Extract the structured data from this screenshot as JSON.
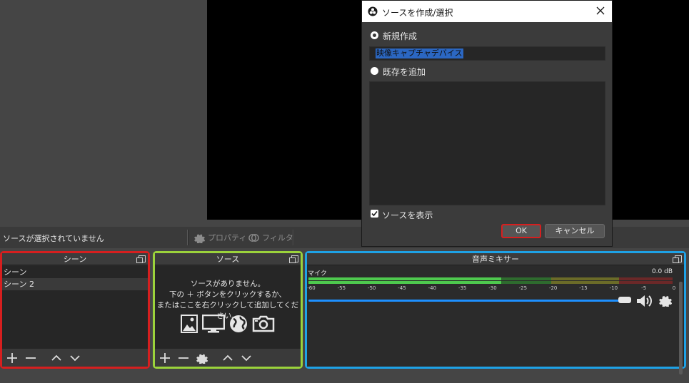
{
  "context_bar": {
    "status": "ソースが選択されていません",
    "properties_label": "プロパティ",
    "filters_label": "フィルタ"
  },
  "scenes_dock": {
    "title": "シーン",
    "items": [
      "シーン",
      "シーン 2"
    ]
  },
  "sources_dock": {
    "title": "ソース",
    "empty_line1": "ソースがありません。",
    "empty_line2": "下の ＋ ボタンをクリックするか、",
    "empty_line3": "またはここを右クリックして追加してください。",
    "icons": [
      "image-icon",
      "display-icon",
      "browser-globe-icon",
      "camera-icon"
    ]
  },
  "mixer_dock": {
    "title": "音声ミキサー",
    "channel_name": "マイク",
    "db_value": "0.0 dB",
    "ticks": [
      "-60",
      "-55",
      "-50",
      "-45",
      "-40",
      "-35",
      "-30",
      "-25",
      "-20",
      "-15",
      "-10",
      "-5",
      "0"
    ],
    "volume_level": 1.0
  },
  "dialog": {
    "title": "ソースを作成/選択",
    "create_new_label": "新規作成",
    "source_name_value": "映像キャプチャデバイス",
    "add_existing_label": "既存を追加",
    "show_source_label": "ソースを表示",
    "ok_label": "OK",
    "cancel_label": "キャンセル"
  },
  "colors": {
    "scenes_highlight": "#d61f1f",
    "sources_highlight": "#9bd33b",
    "mixer_highlight": "#1ea2e6",
    "ok_highlight": "#d61f1f"
  }
}
